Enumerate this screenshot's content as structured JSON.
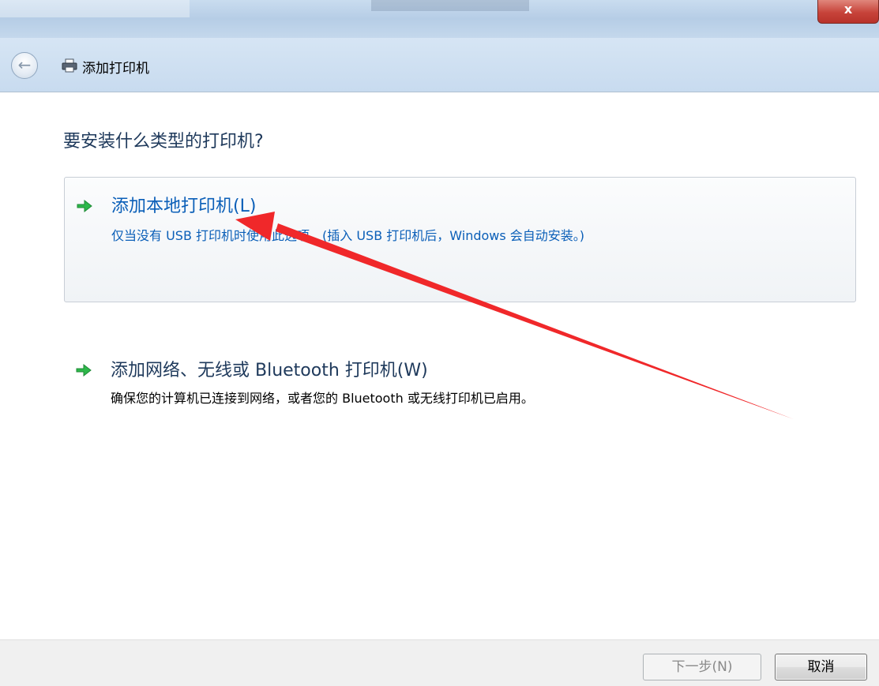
{
  "window": {
    "close_label": "x",
    "title": "添加打印机"
  },
  "question": "要安装什么类型的打印机?",
  "options": [
    {
      "title": "添加本地打印机(L)",
      "description": "仅当没有 USB 打印机时使用此选项。(插入 USB 打印机后，Windows 会自动安装。)",
      "icon": "green-arrow-icon"
    },
    {
      "title": "添加网络、无线或 Bluetooth 打印机(W)",
      "description": "确保您的计算机已连接到网络，或者您的 Bluetooth 或无线打印机已启用。",
      "icon": "green-arrow-icon"
    }
  ],
  "buttons": {
    "next_label": "下一步(N)",
    "cancel_label": "取消"
  },
  "colors": {
    "link_blue": "#0b5fb8",
    "heading_blue": "#1e395b",
    "arrow_green": "#2db84a",
    "annotation_red": "#f0282a"
  }
}
